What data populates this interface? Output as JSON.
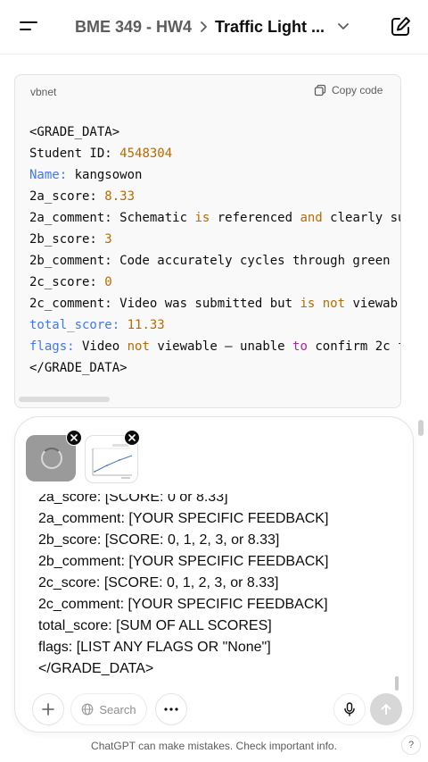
{
  "header": {
    "project": "BME 349 - HW4",
    "conversation": "Traffic Light ..."
  },
  "code_block": {
    "language": "vbnet",
    "copy_label": "Copy code",
    "lines": [
      [
        {
          "t": "<GRADE_DATA>",
          "c": ""
        }
      ],
      [
        {
          "t": "Student ID: ",
          "c": ""
        },
        {
          "t": "4548304",
          "c": "c-num"
        }
      ],
      [
        {
          "t": "Name:",
          "c": "c-key"
        },
        {
          "t": " kangsowon",
          "c": ""
        }
      ],
      [
        {
          "t": "2a_score: ",
          "c": ""
        },
        {
          "t": "8.33",
          "c": "c-num"
        }
      ],
      [
        {
          "t": "2a_comment: Schematic ",
          "c": ""
        },
        {
          "t": "is",
          "c": "c-kw2"
        },
        {
          "t": " referenced ",
          "c": ""
        },
        {
          "t": "and",
          "c": "c-kw2"
        },
        {
          "t": " clearly su",
          "c": ""
        }
      ],
      [
        {
          "t": "2b_score: ",
          "c": ""
        },
        {
          "t": "3",
          "c": "c-num"
        }
      ],
      [
        {
          "t": "2b_comment: Code accurately cycles through green",
          "c": ""
        }
      ],
      [
        {
          "t": "2c_score: ",
          "c": ""
        },
        {
          "t": "0",
          "c": "c-num"
        }
      ],
      [
        {
          "t": "2c_comment: Video was submitted but ",
          "c": ""
        },
        {
          "t": "is",
          "c": "c-kw2"
        },
        {
          "t": " ",
          "c": ""
        },
        {
          "t": "not",
          "c": "c-kw2"
        },
        {
          "t": " viewab",
          "c": ""
        }
      ],
      [
        {
          "t": "total_score:",
          "c": "c-key"
        },
        {
          "t": " ",
          "c": ""
        },
        {
          "t": "11.33",
          "c": "c-num"
        }
      ],
      [
        {
          "t": "flags:",
          "c": "c-key"
        },
        {
          "t": " Video ",
          "c": ""
        },
        {
          "t": "not",
          "c": "c-kw2"
        },
        {
          "t": " viewable — unable ",
          "c": ""
        },
        {
          "t": "to",
          "c": "c-kw"
        },
        {
          "t": " confirm 2c f",
          "c": ""
        }
      ],
      [
        {
          "t": "</GRADE_DATA>",
          "c": ""
        }
      ]
    ]
  },
  "composer": {
    "lines": [
      "2a_score: [SCORE: 0 or 8.33]",
      "2a_comment: [YOUR SPECIFIC FEEDBACK]",
      "2b_score: [SCORE: 0, 1, 2, 3, or 8.33]",
      "2b_comment: [YOUR SPECIFIC FEEDBACK]",
      "2c_score: [SCORE: 0, 1, 2, 3, or 8.33]",
      "2c_comment: [YOUR SPECIFIC FEEDBACK]",
      "total_score: [SUM OF ALL SCORES]",
      "flags: [LIST ANY FLAGS OR \"None\"]",
      "</GRADE_DATA>"
    ],
    "search_label": "Search"
  },
  "footer": {
    "disclaimer": "ChatGPT can make mistakes. Check important info.",
    "help": "?"
  },
  "icons": {
    "menu": "menu-icon",
    "edit": "new-chat-icon",
    "copy": "copy-icon",
    "plus": "plus-icon",
    "search": "globe-icon",
    "more": "more-icon",
    "mic": "mic-icon",
    "send": "arrow-up-icon"
  },
  "colors": {
    "keyword": "#a626a4",
    "number": "#b76b01",
    "key": "#4078f2",
    "send_disabled": "#d7d7d7"
  }
}
